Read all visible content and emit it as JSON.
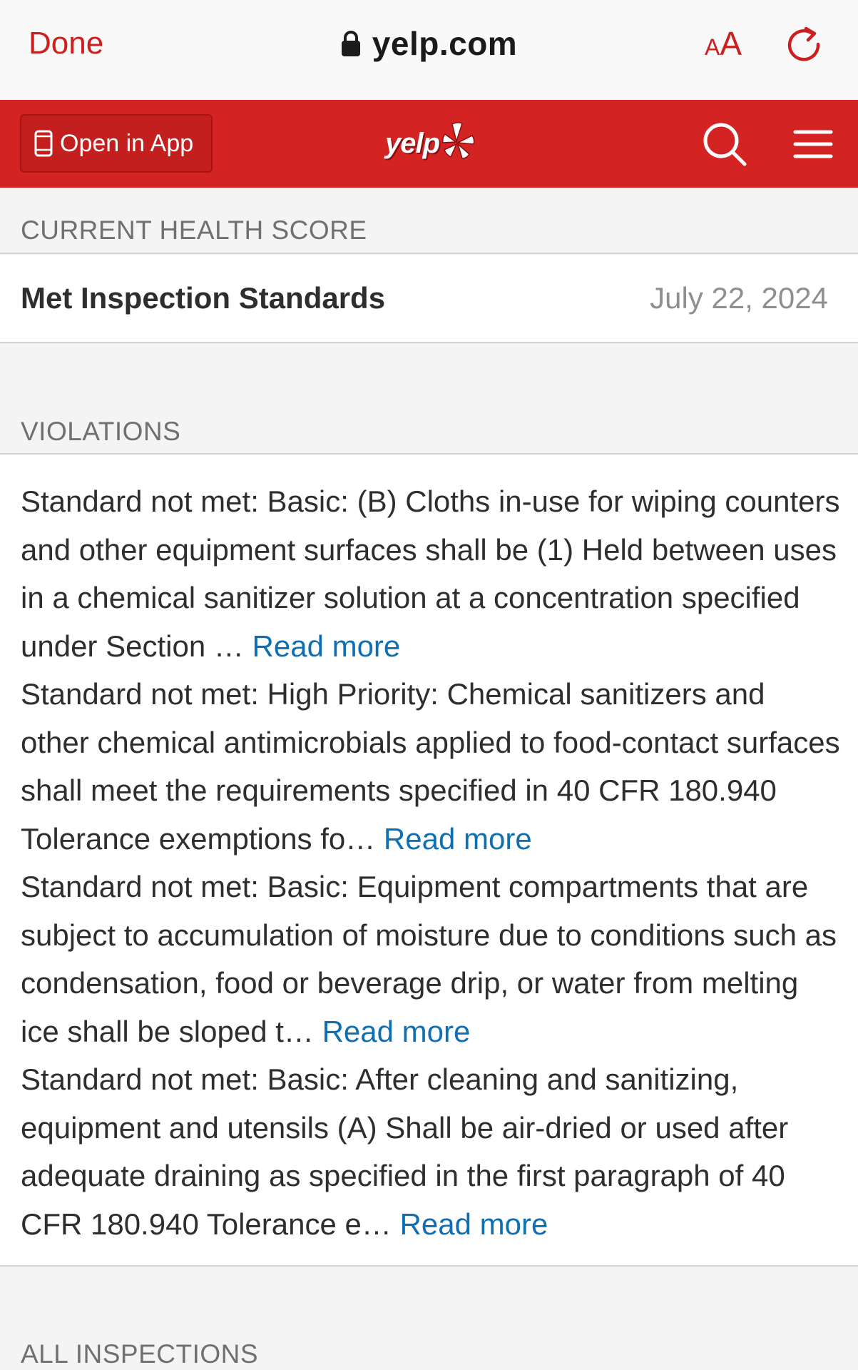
{
  "browser": {
    "done_label": "Done",
    "url": "yelp.com",
    "text_size_small": "A",
    "text_size_large": "A"
  },
  "header": {
    "open_in_app_label": "Open in App",
    "logo_text": "yelp",
    "brand_color": "#d32323"
  },
  "health_score": {
    "section_label": "CURRENT HEALTH SCORE",
    "status": "Met Inspection Standards",
    "date": "July 22, 2024"
  },
  "violations": {
    "section_label": "VIOLATIONS",
    "read_more_label": "Read more",
    "items": [
      {
        "text": "Standard not met: Basic: (B) Cloths in-use for wiping counters and other equipment surfaces shall be (1) Held between uses in a chemical sanitizer solution at a concentration specified under Section … "
      },
      {
        "text": "Standard not met: High Priority: Chemical sanitizers and other chemical antimicrobials applied to food-contact surfaces shall meet the requirements specified in 40 CFR 180.940 Tolerance exemptions fo… "
      },
      {
        "text": "Standard not met: Basic: Equipment compartments that are subject to accumulation of moisture due to conditions such as condensation, food or beverage drip, or water from melting ice shall be sloped t… "
      },
      {
        "text": "Standard not met: Basic: After cleaning and sanitizing, equipment and utensils (A) Shall be air-dried or used after adequate draining as specified in the first paragraph of 40 CFR 180.940 Tolerance e… "
      }
    ]
  },
  "all_inspections": {
    "section_label": "ALL INSPECTIONS"
  }
}
